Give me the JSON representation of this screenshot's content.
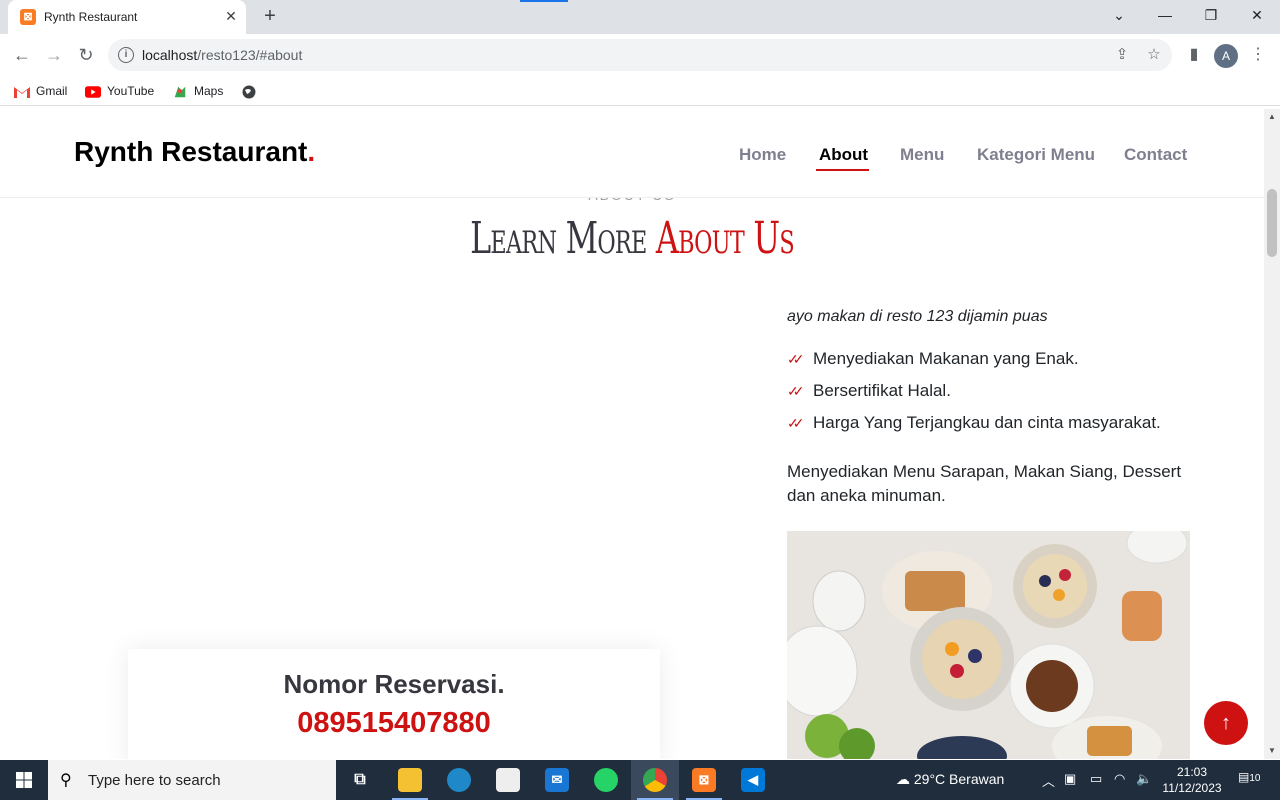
{
  "browser": {
    "tab_title": "Rynth Restaurant",
    "url_host": "localhost",
    "url_path": "/resto123/#about",
    "profile_initial": "A",
    "bookmarks": [
      "Gmail",
      "YouTube",
      "Maps"
    ]
  },
  "site": {
    "logo_text": "Rynth Restaurant",
    "logo_dot": ".",
    "nav": [
      {
        "label": "Home",
        "active": false
      },
      {
        "label": "About",
        "active": true
      },
      {
        "label": "Menu",
        "active": false
      },
      {
        "label": "Kategori Menu",
        "active": false
      },
      {
        "label": "Contact",
        "active": false
      }
    ],
    "accent_color": "#ce1212"
  },
  "about": {
    "subtitle": "ABOUT US",
    "title_part1": "Learn More",
    "title_part2": "About Us",
    "tagline": "ayo makan di resto 123 dijamin puas",
    "checklist": [
      "Menyediakan Makanan yang Enak.",
      "Bersertifikat Halal.",
      "Harga Yang Terjangkau dan cinta masyarakat."
    ],
    "paragraph": "Menyediakan Menu Sarapan, Makan Siang, Dessert dan aneka minuman.",
    "reservation_title": "Nomor Reservasi.",
    "reservation_phone": "089515407880"
  },
  "taskbar": {
    "search_placeholder": "Type here to search",
    "weather": "29°C  Berawan",
    "time": "21:03",
    "date": "11/12/2023",
    "notification_count": "10"
  }
}
